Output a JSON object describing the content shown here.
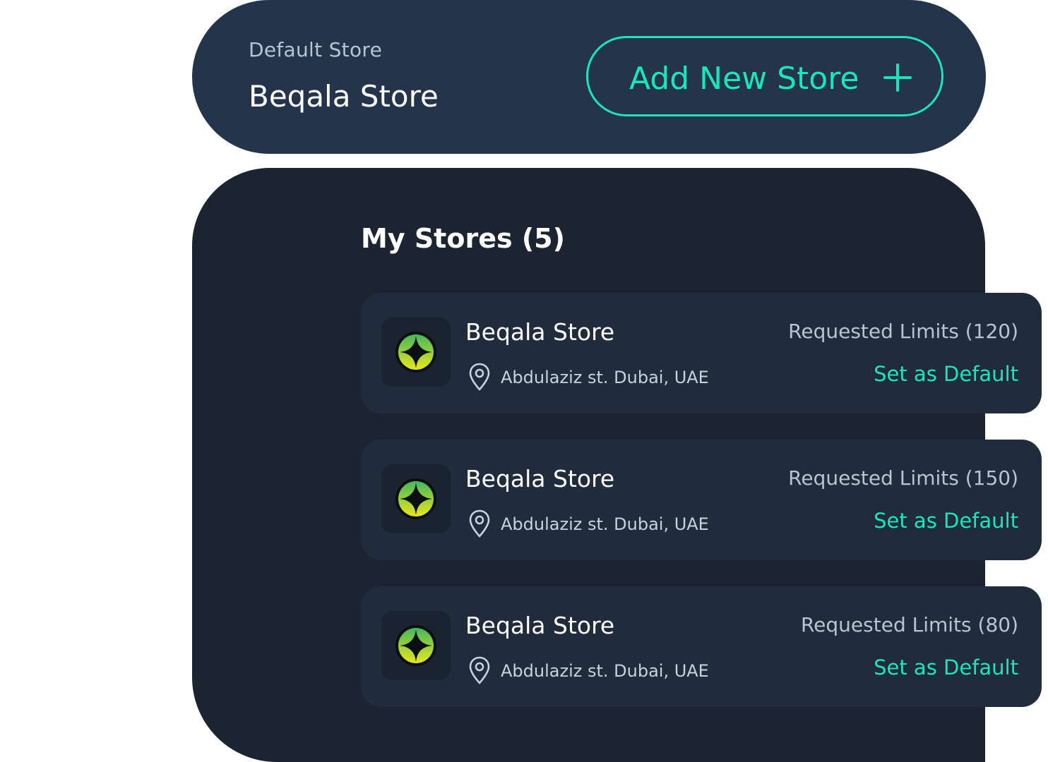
{
  "header": {
    "default_label": "Default Store",
    "default_store_name": "Beqala Store",
    "add_button_label": "Add New Store"
  },
  "stores_section": {
    "title": "My Stores (5)",
    "items": [
      {
        "name": "Beqala Store",
        "address": "Abdulaziz st. Dubai, UAE",
        "limits": "Requested Limits (120)",
        "action": "Set as Default"
      },
      {
        "name": "Beqala Store",
        "address": "Abdulaziz st. Dubai, UAE",
        "limits": "Requested Limits (150)",
        "action": "Set as Default"
      },
      {
        "name": "Beqala Store",
        "address": "Abdulaziz st. Dubai, UAE",
        "limits": "Requested Limits (80)",
        "action": "Set as Default"
      }
    ]
  },
  "colors": {
    "accent": "#19e6b9",
    "header_bg": "#24344a",
    "panel_bg": "#1b2430",
    "card_bg": "#202b3b"
  },
  "icons": {
    "add": "plus-icon",
    "store_logo": "store-logo-icon",
    "location": "location-pin-icon"
  }
}
